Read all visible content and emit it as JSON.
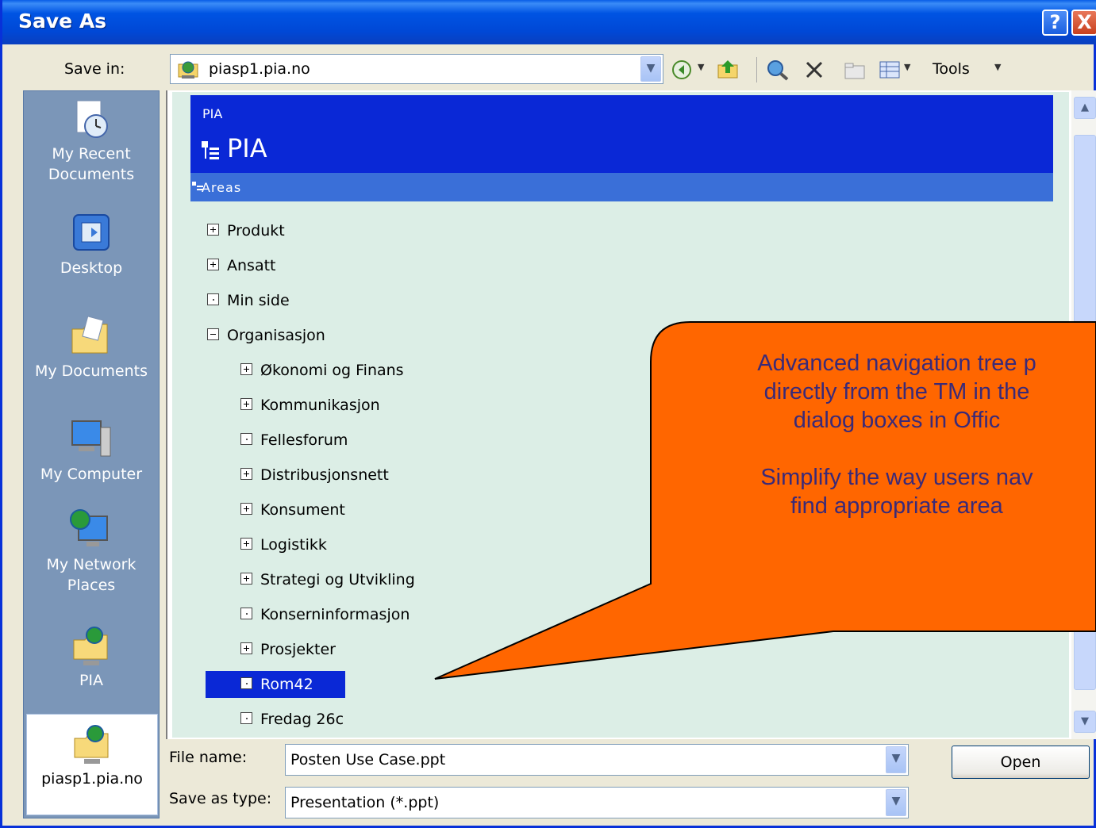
{
  "window": {
    "title": "Save As",
    "help_glyph": "?",
    "close_glyph": "X"
  },
  "save_in": {
    "label": "Save in:",
    "value": "piasp1.pia.no"
  },
  "toolbar": {
    "icons": [
      "back-icon",
      "up-folder-icon",
      "search-web-icon",
      "delete-icon",
      "new-folder-icon",
      "views-icon"
    ],
    "tools_label": "Tools"
  },
  "places": [
    {
      "label": "My Recent Documents",
      "line1": "My Recent",
      "line2": "Documents",
      "icon": "recent-documents-icon"
    },
    {
      "label": "Desktop",
      "line1": "Desktop",
      "line2": "",
      "icon": "desktop-icon"
    },
    {
      "label": "My Documents",
      "line1": "My Documents",
      "line2": "",
      "icon": "my-documents-icon"
    },
    {
      "label": "My Computer",
      "line1": "My Computer",
      "line2": "",
      "icon": "my-computer-icon"
    },
    {
      "label": "My Network Places",
      "line1": "My Network",
      "line2": "Places",
      "icon": "network-places-icon"
    },
    {
      "label": "PIA",
      "line1": "PIA",
      "line2": "",
      "icon": "web-folder-icon"
    },
    {
      "label": "piasp1.pia.no",
      "line1": "piasp1.pia.no",
      "line2": "",
      "icon": "web-folder-icon",
      "selected": true
    }
  ],
  "site": {
    "small_title": "PIA",
    "big_title": "PIA",
    "section": "Areas"
  },
  "tree": [
    {
      "label": "Produkt",
      "state": "plus",
      "level": 0
    },
    {
      "label": "Ansatt",
      "state": "plus",
      "level": 0
    },
    {
      "label": "Min side",
      "state": "leaf",
      "level": 0
    },
    {
      "label": "Organisasjon",
      "state": "minus",
      "level": 0
    },
    {
      "label": "Økonomi og Finans",
      "state": "plus",
      "level": 1
    },
    {
      "label": "Kommunikasjon",
      "state": "plus",
      "level": 1
    },
    {
      "label": "Fellesforum",
      "state": "leaf",
      "level": 1
    },
    {
      "label": "Distribusjonsnett",
      "state": "plus",
      "level": 1
    },
    {
      "label": "Konsument",
      "state": "plus",
      "level": 1
    },
    {
      "label": "Logistikk",
      "state": "plus",
      "level": 1
    },
    {
      "label": "Strategi og Utvikling",
      "state": "plus",
      "level": 1
    },
    {
      "label": "Konserninformasjon",
      "state": "leaf",
      "level": 1
    },
    {
      "label": "Prosjekter",
      "state": "plus",
      "level": 1
    },
    {
      "label": "Rom42",
      "state": "leaf",
      "level": 1,
      "selected": true
    },
    {
      "label": "Fredag 26c",
      "state": "leaf",
      "level": 1
    }
  ],
  "file_name": {
    "label": "File name:",
    "value": "Posten Use Case.ppt"
  },
  "save_as_type": {
    "label": "Save as type:",
    "value": "Presentation (*.ppt)"
  },
  "open_button": "Open",
  "callout": {
    "line1": "Advanced navigation tree p",
    "line2": "directly from the TM in the",
    "line3": "dialog boxes in Offic",
    "line4": "Simplify the way users nav",
    "line5": "find appropriate area",
    "fill_color": "#ff6600"
  }
}
